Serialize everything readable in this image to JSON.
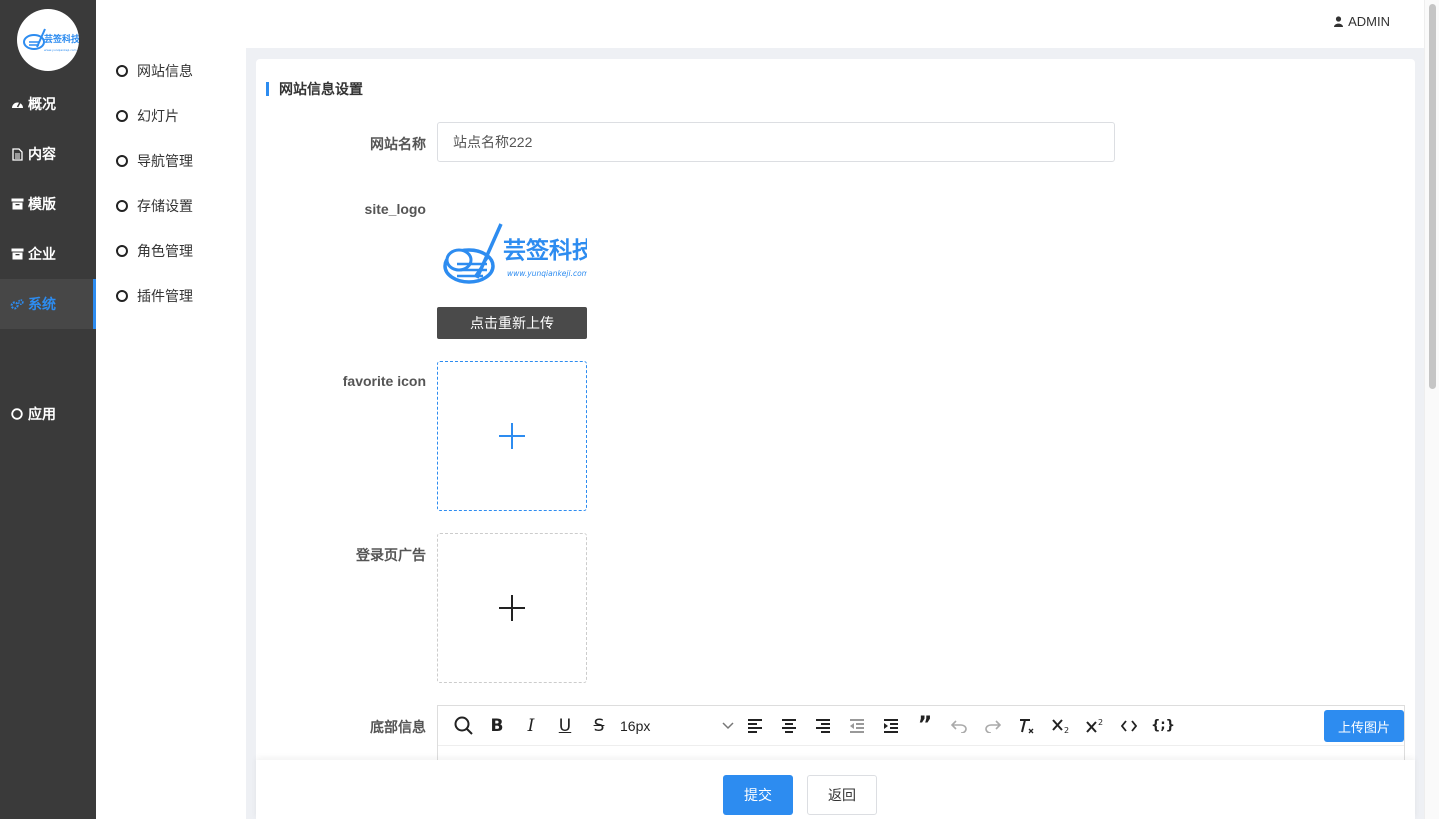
{
  "brand": {
    "logo_text": "芸签科技",
    "logo_url": "www.yunqiankeji.com",
    "brand_color": "#2d8cf0"
  },
  "header": {
    "user": "ADMIN"
  },
  "sidebar": {
    "items": [
      {
        "label": "概况",
        "icon": "dashboard-icon"
      },
      {
        "label": "内容",
        "icon": "document-icon"
      },
      {
        "label": "模版",
        "icon": "archive-icon"
      },
      {
        "label": "企业",
        "icon": "archive-icon"
      },
      {
        "label": "系统",
        "icon": "cogs-icon",
        "active": true
      },
      {
        "label": "应用",
        "icon": "circle-icon"
      }
    ]
  },
  "subnav": {
    "items": [
      {
        "label": "网站信息"
      },
      {
        "label": "幻灯片"
      },
      {
        "label": "导航管理"
      },
      {
        "label": "存储设置"
      },
      {
        "label": "角色管理"
      },
      {
        "label": "插件管理"
      }
    ]
  },
  "main": {
    "title": "网站信息设置",
    "fields": {
      "site_name": {
        "label": "网站名称",
        "value": "站点名称222"
      },
      "site_logo": {
        "label": "site_logo",
        "reupload": "点击重新上传"
      },
      "favicon": {
        "label": "favorite icon"
      },
      "login_ad": {
        "label": "登录页广告"
      },
      "footer_info": {
        "label": "底部信息"
      }
    },
    "editor": {
      "font_size": "16px",
      "upload_image": "上传图片"
    }
  },
  "footer": {
    "submit": "提交",
    "back": "返回"
  }
}
